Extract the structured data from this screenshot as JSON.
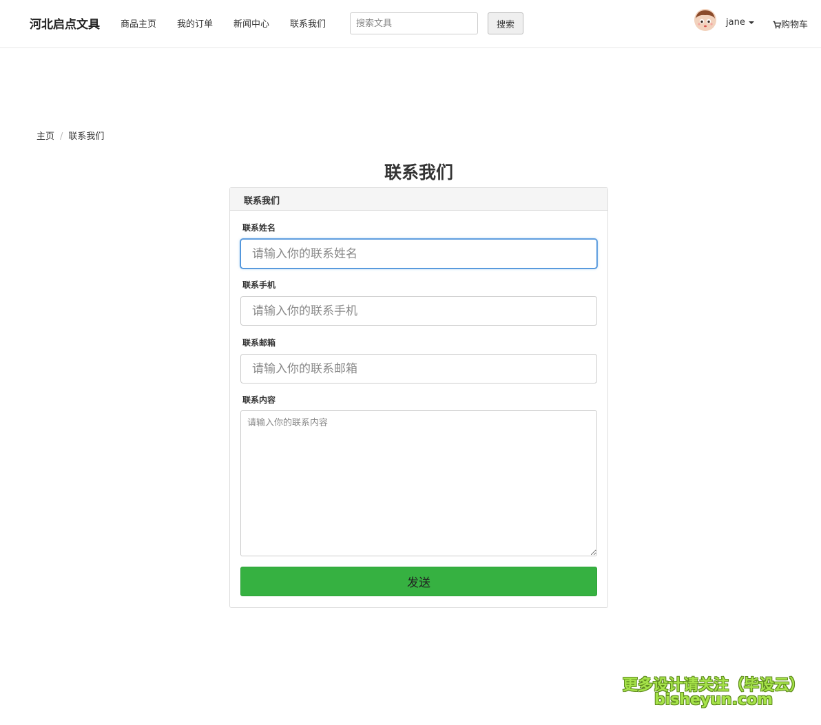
{
  "navbar": {
    "brand": "河北启点文具",
    "links": [
      "商品主页",
      "我的订单",
      "新闻中心",
      "联系我们"
    ],
    "search": {
      "placeholder": "搜索文具",
      "button_label": "搜索"
    },
    "user": {
      "name": "jane"
    },
    "cart_label": "购物车"
  },
  "breadcrumb": {
    "home": "主页",
    "separator": "/",
    "current": "联系我们"
  },
  "page": {
    "heading": "联系我们",
    "panel_title": "联系我们",
    "form": {
      "name": {
        "label": "联系姓名",
        "placeholder": "请输入你的联系姓名"
      },
      "phone": {
        "label": "联系手机",
        "placeholder": "请输入你的联系手机"
      },
      "email": {
        "label": "联系邮箱",
        "placeholder": "请输入你的联系邮箱"
      },
      "content": {
        "label": "联系内容",
        "placeholder": "请输入你的联系内容"
      },
      "submit_label": "发送"
    }
  },
  "watermark": {
    "line1": "更多设计请关注（毕设云）",
    "line2": "bisheyun.com"
  },
  "colors": {
    "accent_green": "#36b141",
    "focus_blue": "#4a90d9",
    "watermark_green": "#a6e34a"
  }
}
